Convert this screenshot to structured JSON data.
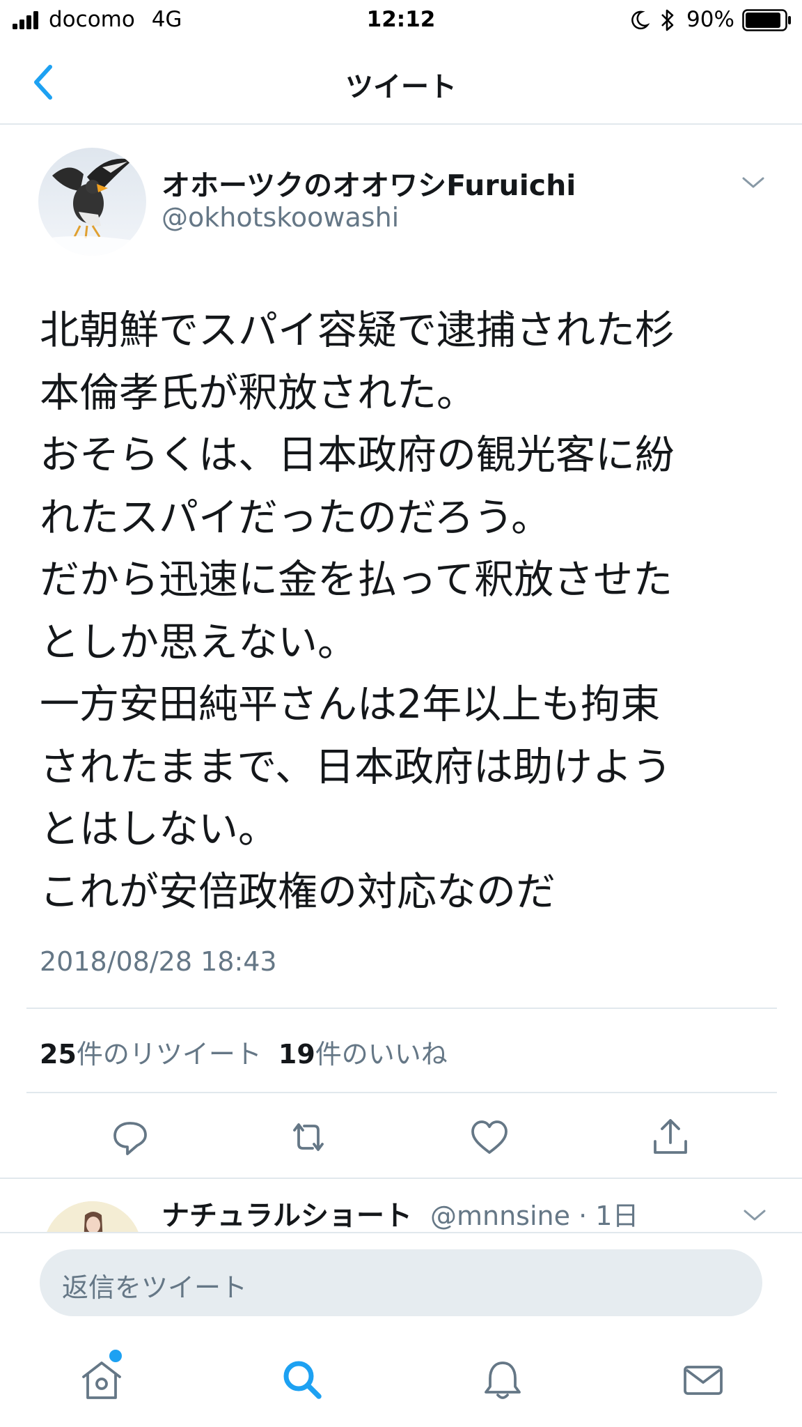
{
  "status_bar": {
    "carrier": "docomo",
    "network": "4G",
    "time": "12:12",
    "battery_percent": "90%",
    "battery_level": 0.9
  },
  "nav": {
    "title": "ツイート"
  },
  "tweet": {
    "display_name": "オホーツクのオオワシFuruichi",
    "handle": "@okhotskoowashi",
    "lines": [
      "北朝鮮でスパイ容疑で逮捕された杉",
      "本倫孝氏が釈放された。",
      "おそらくは、日本政府の観光客に紛",
      "れたスパイだったのだろう。",
      "だから迅速に金を払って釈放させた",
      "としか思えない。",
      "一方安田純平さんは2年以上も拘束",
      "されたままで、日本政府は助けよう",
      "とはしない。",
      "これが安倍政権の対応なのだ"
    ],
    "timestamp": "2018/08/28 18:43",
    "retweet_count": "25",
    "retweet_label": "件のリツイート",
    "like_count": "19",
    "like_label": "件のいいね"
  },
  "reply_preview": {
    "display_name": "ナチュラルショート",
    "handle": "@mnnsine",
    "time": "1日"
  },
  "reply_box": {
    "placeholder": "返信をツイート"
  },
  "icons": {
    "back": "chevron-left-icon",
    "caret": "chevron-down-icon",
    "reply": "reply-icon",
    "retweet": "retweet-icon",
    "like": "heart-icon",
    "share": "share-icon",
    "home": "home-icon",
    "search": "search-icon",
    "notifications": "bell-icon",
    "messages": "mail-icon"
  },
  "colors": {
    "accent": "#1da1f2",
    "text": "#14171a",
    "secondary": "#657786",
    "divider": "#e1e8ed",
    "reply_box": "#e6ecf0",
    "icon": "#657786"
  }
}
